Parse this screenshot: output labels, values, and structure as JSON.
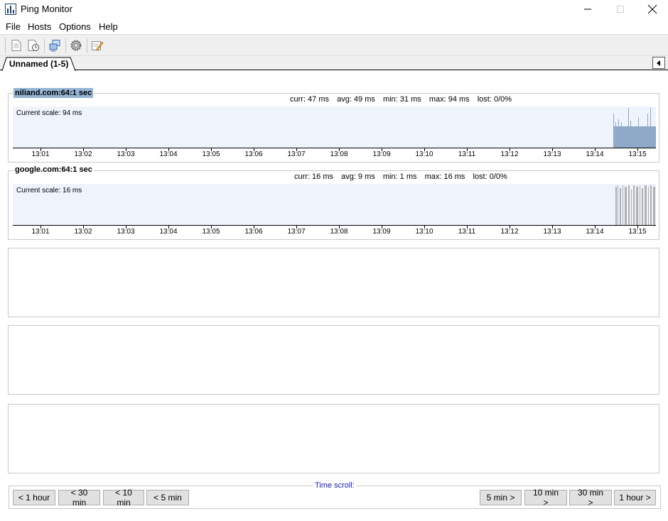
{
  "window": {
    "title": "Ping Monitor"
  },
  "menu": {
    "items": [
      "File",
      "Hosts",
      "Options",
      "Help"
    ]
  },
  "tabs": [
    {
      "label": "Unnamed (1-5)"
    }
  ],
  "time_labels": [
    "13:01",
    "13:02",
    "13:03",
    "13:04",
    "13:05",
    "13:06",
    "13:07",
    "13:08",
    "13:09",
    "13:10",
    "13:11",
    "13:12",
    "13:13",
    "13:14",
    "13:15"
  ],
  "hosts": [
    {
      "title": "niliand.com:64:1 sec",
      "stats": {
        "curr": "curr: 47 ms",
        "avg": "avg: 49 ms",
        "min": "min: 31 ms",
        "max": "max: 94 ms",
        "lost": "lost: 0/0%"
      },
      "scale": "Current scale: 94 ms",
      "bar_color": "#8fa9c9",
      "spike_color": "#8fa9c9"
    },
    {
      "title": "google.com:64:1 sec",
      "stats": {
        "curr": "curr: 16 ms",
        "avg": "avg: 9 ms",
        "min": "min: 1 ms",
        "max": "max: 16 ms",
        "lost": "lost: 0/0%"
      },
      "scale": "Current scale: 16 ms",
      "bar_color": "#b0b0b0",
      "spike_color": "#b0b0b0"
    }
  ],
  "time_scroll": {
    "legend": "Time scroll:",
    "back": [
      "< 1 hour",
      "< 30 min",
      "< 10 min",
      "< 5 min"
    ],
    "forward": [
      "5 min >",
      "10 min >",
      "30 min >",
      "1 hour >"
    ]
  },
  "colors": {
    "graph_bg": "#eef3fc",
    "selected_title": "#94b4d4",
    "scroll_legend": "#1a1ab4"
  },
  "icons": [
    "app-chart-icon",
    "minimize-icon",
    "maximize-icon",
    "close-icon",
    "new-document-icon",
    "schedule-icon",
    "hosts-icon",
    "settings-gear-icon",
    "edit-notes-icon",
    "tab-scroll-left-icon"
  ]
}
